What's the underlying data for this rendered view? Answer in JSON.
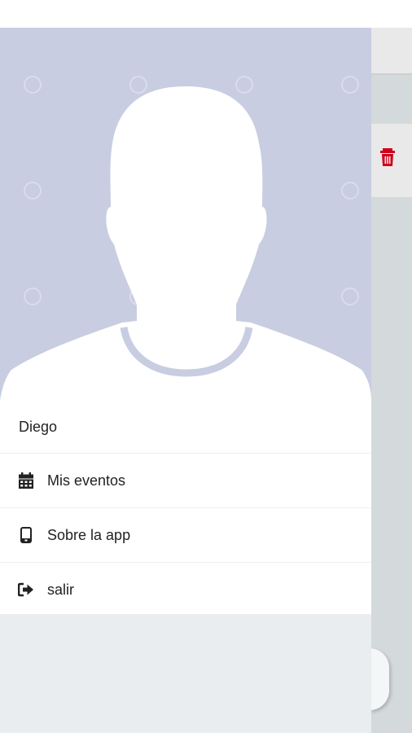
{
  "user": {
    "name": "Diego"
  },
  "menu": {
    "items": [
      {
        "label": "Mis eventos",
        "icon": "calendar-icon"
      },
      {
        "label": "Sobre la app",
        "icon": "smartphone-icon"
      },
      {
        "label": "salir",
        "icon": "logout-icon"
      }
    ]
  },
  "colors": {
    "hero_background": "#c8cde1",
    "drawer_background": "#e9edf0",
    "delete_icon": "#d0021b"
  },
  "background_app": {
    "delete_icon": "trash-icon"
  }
}
